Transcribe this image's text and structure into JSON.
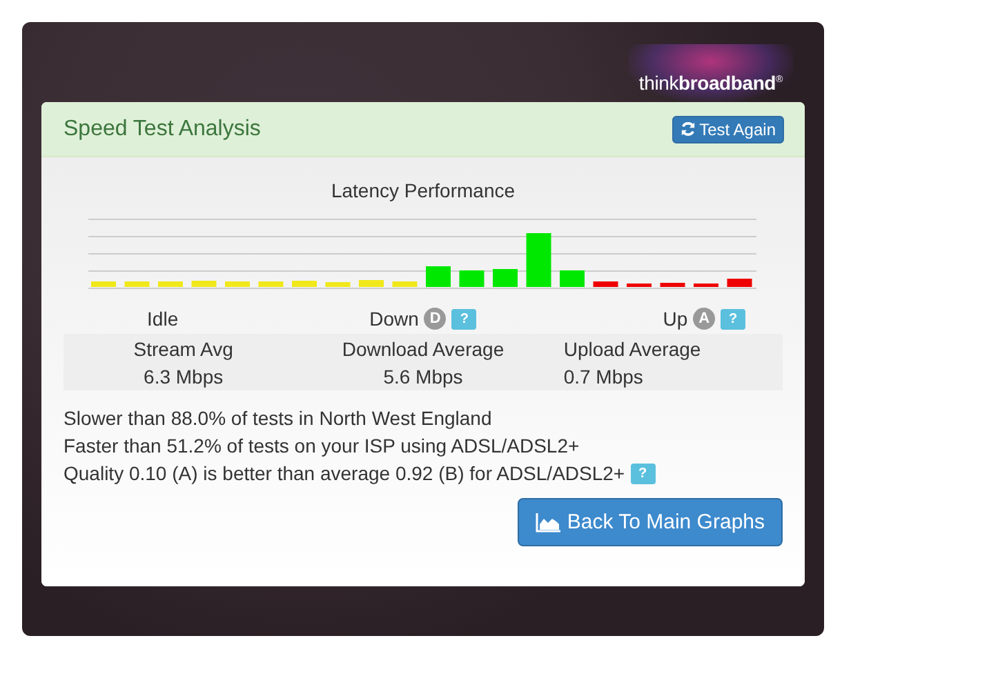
{
  "logo": {
    "text": "think**broadband**",
    "mark": "®"
  },
  "panel": {
    "title": "Speed Test Analysis",
    "action": "Test Again"
  },
  "chart": {
    "title": "Latency Performance"
  },
  "phases": [
    {
      "label": "Idle"
    },
    {
      "label": "Down",
      "grade": "D",
      "help": "?"
    },
    {
      "label": "Up",
      "grade": "A",
      "help": "?"
    }
  ],
  "stats": [
    {
      "label": "Stream Avg",
      "value": "6.3 Mbps"
    },
    {
      "label": "Download Average",
      "value": "5.6 Mbps"
    },
    {
      "label": "Upload Average",
      "value": "0.7 Mbps"
    }
  ],
  "notes": [
    {
      "text": "Slower than 88.0% of tests in North West England"
    },
    {
      "text": "Faster than 51.2% of tests on your ISP using ADSL/ADSL2+"
    },
    {
      "text": "Quality 0.10 (A) is better than average 0.92 (B) for ADSL/ADSL2+",
      "help": "?"
    }
  ],
  "footer_button": "Back To Main Graphs"
}
